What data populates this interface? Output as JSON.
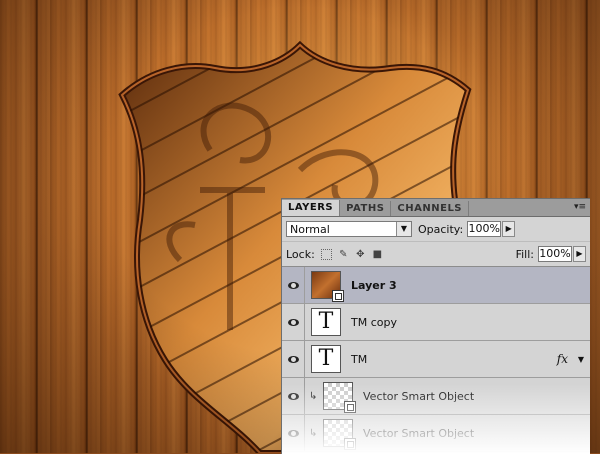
{
  "panel": {
    "tabs": [
      {
        "label": "LAYERS",
        "active": true
      },
      {
        "label": "PATHS",
        "active": false
      },
      {
        "label": "CHANNELS",
        "active": false
      }
    ],
    "menu_icon": "panel-menu-icon",
    "blend_mode": "Normal",
    "opacity_label": "Opacity:",
    "opacity_value": "100%",
    "lock_label": "Lock:",
    "fill_label": "Fill:",
    "fill_value": "100%"
  },
  "layers": [
    {
      "name": "Layer 3",
      "selected": true
    },
    {
      "name": "TM copy",
      "selected": false
    },
    {
      "name": "TM",
      "selected": false,
      "fx": "fx"
    },
    {
      "name": "Vector Smart Object",
      "selected": false
    },
    {
      "name": "Vector Smart Object",
      "selected": false
    }
  ],
  "colors": {
    "wood": "#a85e24",
    "panel_bg": "#d4d4d4",
    "selected_row": "#b4b6c3"
  }
}
